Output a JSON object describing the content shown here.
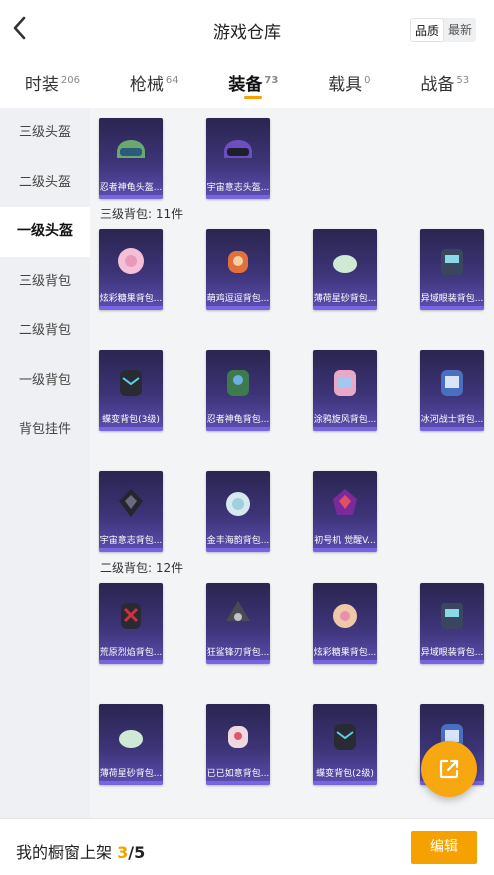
{
  "header": {
    "title": "游戏仓库",
    "sort_options": [
      "品质",
      "最新"
    ],
    "active_sort": 0
  },
  "tabs": [
    {
      "label": "时装",
      "count": "206"
    },
    {
      "label": "枪械",
      "count": "64"
    },
    {
      "label": "装备",
      "count": "73",
      "active": true
    },
    {
      "label": "载具",
      "count": "0"
    },
    {
      "label": "战备",
      "count": "53"
    }
  ],
  "sidebar": {
    "items": [
      "三级头盔",
      "二级头盔",
      "一级头盔",
      "三级背包",
      "二级背包",
      "一级背包",
      "背包挂件"
    ],
    "active_index": 2
  },
  "sections": [
    {
      "label": "",
      "items": [
        "忍者神龟头盔...",
        "宇宙意志头盔..."
      ]
    },
    {
      "label": "三级背包: 11件",
      "items": [
        "炫彩糖果背包...",
        "萌鸡逗逗背包...",
        "薄荷星砂背包...",
        "异域眼装背包...",
        "蝶变背包(3级)",
        "忍者神龟背包...",
        "涂鸦旋风背包...",
        "冰河战士背包...",
        "宇宙意志背包...",
        "金丰海韵背包...",
        "初号机 觉醒V..."
      ]
    },
    {
      "label": "二级背包: 12件",
      "items": [
        "荒原烈焰背包...",
        "狂鲨锋刃背包...",
        "炫彩糖果背包...",
        "异域眼装背包...",
        "薄荷星砂背包...",
        "已已如意背包...",
        "蝶变背包(2级)",
        "..."
      ]
    }
  ],
  "bottom_bar": {
    "label": "我的橱窗上架",
    "current": "3",
    "total": "/5",
    "edit_label": "编辑"
  },
  "colors": {
    "accent": "#f5a100",
    "card_bg": "#3d3478"
  },
  "icons": {
    "back": "chevron-left-icon",
    "share": "external-link-icon"
  }
}
